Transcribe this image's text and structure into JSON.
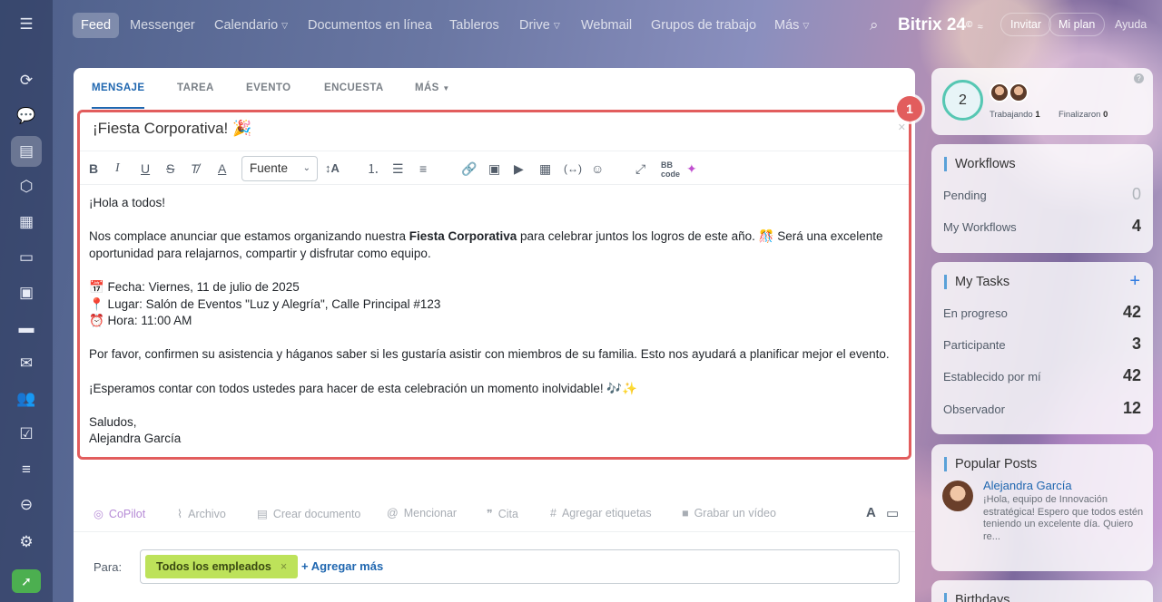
{
  "nav": {
    "items": [
      {
        "label": "Feed",
        "active": true
      },
      {
        "label": "Messenger"
      },
      {
        "label": "Calendario"
      },
      {
        "label": "Documentos en línea"
      },
      {
        "label": "Tableros"
      },
      {
        "label": "Drive"
      },
      {
        "label": "Webmail"
      },
      {
        "label": "Grupos de trabajo"
      },
      {
        "label": "Más"
      }
    ],
    "brand": "Bitrix 24",
    "brand_mark": "©",
    "invite": "Invitar",
    "my_plan": "Mi plan",
    "help": "Ayuda"
  },
  "composer": {
    "tabs": [
      "MENSAJE",
      "TAREA",
      "EVENTO",
      "ENCUESTA",
      "MÁS"
    ],
    "callout_number": "1",
    "subject": "¡Fiesta Corporativa! 🎉",
    "font_label": "Fuente",
    "body": {
      "greeting": "¡Hola a todos!",
      "p1_start": "Nos complace anunciar que estamos organizando nuestra ",
      "p1_bold": "Fiesta Corporativa",
      "p1_end": " para celebrar juntos los logros de este año. 🎊 Será una excelente oportunidad para relajarnos, compartir y disfrutar como equipo.",
      "date_line": "📅 Fecha: Viernes, 11 de julio de 2025",
      "place_line": "📍 Lugar: Salón de Eventos \"Luz y Alegría\", Calle Principal #123",
      "time_line": "⏰ Hora: 11:00 AM",
      "p3": "Por favor, confirmen su asistencia y háganos saber si les gustaría asistir con miembros de su familia. Esto nos ayudará a planificar mejor el evento.",
      "p4": "¡Esperamos contar con todos ustedes para hacer de esta celebración un momento inolvidable! 🎶✨",
      "closing": "Saludos,",
      "signature": "Alejandra García"
    },
    "actions": [
      "CoPilot",
      "Archivo",
      "Crear documento",
      "Mencionar",
      "Cita",
      "Agregar etiquetas",
      "Grabar un vídeo"
    ],
    "to_label": "Para:",
    "recipient": "Todos los empleados",
    "add_more": "+ Agregar más"
  },
  "widgets": {
    "team": {
      "count": "2",
      "working_label": "Trabajando",
      "working": "1",
      "finished_label": "Finalizaron",
      "finished": "0"
    },
    "workflows": {
      "title": "Workflows",
      "rows": [
        {
          "label": "Pending",
          "value": "0"
        },
        {
          "label": "My Workflows",
          "value": "4"
        }
      ]
    },
    "tasks": {
      "title": "My Tasks",
      "rows": [
        {
          "label": "En progreso",
          "value": "42"
        },
        {
          "label": "Participante",
          "value": "3"
        },
        {
          "label": "Establecido por mí",
          "value": "42"
        },
        {
          "label": "Observador",
          "value": "12"
        }
      ]
    },
    "popular": {
      "title": "Popular Posts",
      "author": "Alejandra García",
      "text": "¡Hola, equipo de Innovación estratégica! Espero que todos estén teniendo un excelente día. Quiero re..."
    },
    "birthdays": {
      "title": "Birthdays"
    }
  }
}
